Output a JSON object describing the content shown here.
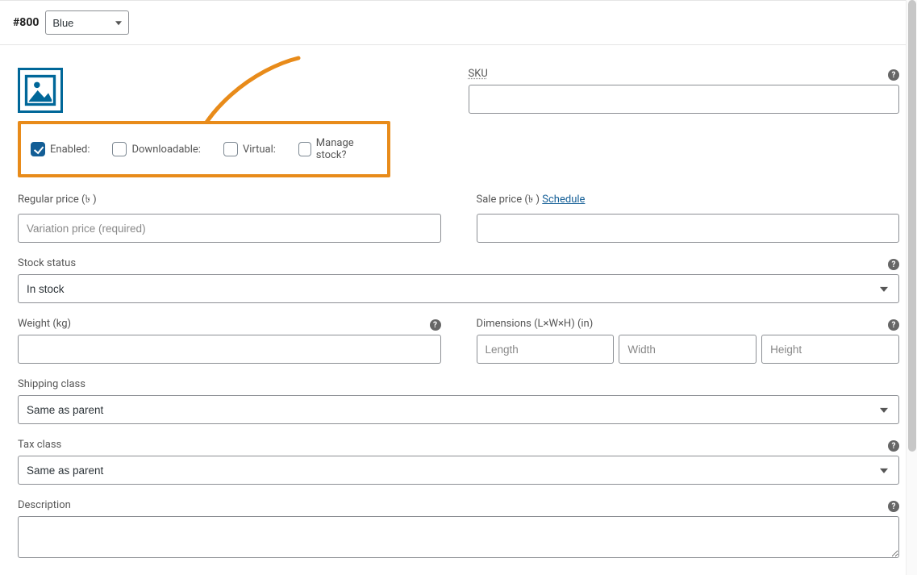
{
  "variation": {
    "id_label": "#800",
    "attribute_options": [
      "Blue"
    ],
    "attribute_selected": "Blue"
  },
  "checkboxes": {
    "enabled": {
      "label": "Enabled:",
      "checked": true
    },
    "downloadable": {
      "label": "Downloadable:",
      "checked": false
    },
    "virtual": {
      "label": "Virtual:",
      "checked": false
    },
    "manage_stock": {
      "label": "Manage stock?",
      "checked": false
    }
  },
  "sku": {
    "label": "SKU",
    "value": ""
  },
  "regular_price": {
    "label": "Regular price (৳ )",
    "placeholder": "Variation price (required)",
    "value": ""
  },
  "sale_price": {
    "label": "Sale price (৳ )",
    "schedule_link": "Schedule",
    "value": ""
  },
  "stock_status": {
    "label": "Stock status",
    "options": [
      "In stock"
    ],
    "selected": "In stock"
  },
  "weight": {
    "label": "Weight (kg)",
    "value": ""
  },
  "dimensions": {
    "label": "Dimensions (L×W×H) (in)",
    "length_placeholder": "Length",
    "width_placeholder": "Width",
    "height_placeholder": "Height",
    "length": "",
    "width": "",
    "height": ""
  },
  "shipping_class": {
    "label": "Shipping class",
    "options": [
      "Same as parent"
    ],
    "selected": "Same as parent"
  },
  "tax_class": {
    "label": "Tax class",
    "options": [
      "Same as parent"
    ],
    "selected": "Same as parent"
  },
  "description": {
    "label": "Description",
    "value": ""
  }
}
